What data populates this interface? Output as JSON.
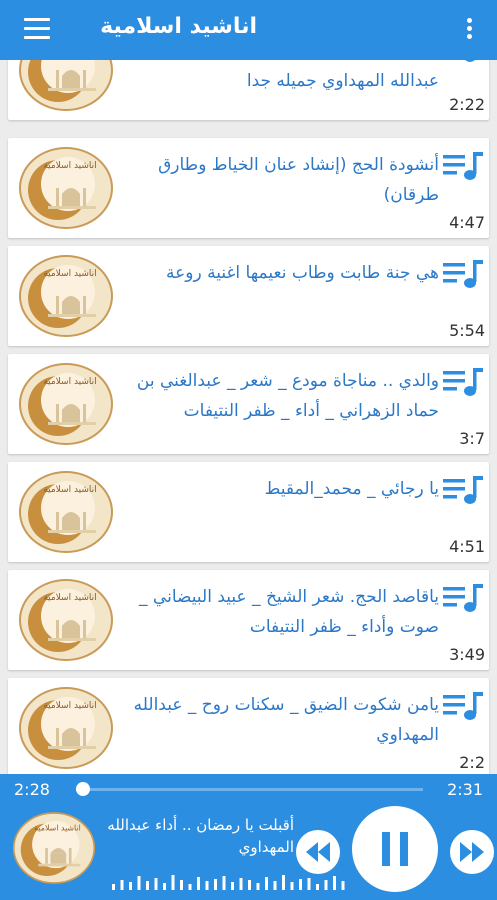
{
  "app": {
    "title": "اناشيد اسلامية"
  },
  "tracks": [
    {
      "title": "عبدالله المهداوي جميله جدا",
      "duration": "2:22"
    },
    {
      "title": "أنشودة الحج (إنشاد عنان الخياط وطارق طرقان)",
      "duration": "4:47"
    },
    {
      "title": "هي جنة طابت وطاب نعيمها اغنية روعة",
      "duration": "5:54"
    },
    {
      "title": "والدي .. مناجاة مودع _ شعر _ عبدالغني بن حماد الزهراني _ أداء _ ظفر النتيفات",
      "duration": "3:7"
    },
    {
      "title": "يا رجائي _ محمد_المقيط",
      "duration": "4:51"
    },
    {
      "title": "ياقاصد الحج. شعر الشيخ _ عبيد البيضاني _ صوت وأداء _ ظفر النتيفات",
      "duration": "3:49"
    },
    {
      "title": "يامن شكوت الضيق _ سكنات روح _ عبدالله المهداوي",
      "duration": "2:2"
    }
  ],
  "player": {
    "current_time": "2:28",
    "total_time": "2:31",
    "progress": 0.02,
    "now_playing": "أقبلت يا رمضان .. أداء عبدالله المهداوي"
  },
  "colors": {
    "accent": "#2c8ee0",
    "title_text": "#2b78c8"
  },
  "icons": [
    "menu-icon",
    "more-vert-icon",
    "playlist-music-icon",
    "pause-icon",
    "rewind-icon",
    "fast-forward-icon",
    "waveform-icon"
  ]
}
